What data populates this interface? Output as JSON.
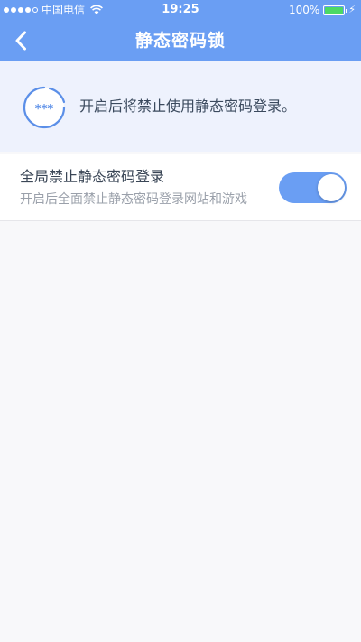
{
  "status_bar": {
    "carrier": "中国电信",
    "time": "19:25",
    "battery_percent": "100%",
    "signal_bars_filled": 4,
    "signal_bars_total": 5
  },
  "nav": {
    "title": "静态密码锁",
    "back_icon": "chevron-left-icon"
  },
  "banner": {
    "icon": "password-lock-icon",
    "icon_text": "***",
    "text": "开启后将禁止使用静态密码登录。"
  },
  "setting": {
    "title": "全局禁止静态密码登录",
    "subtitle": "开启后全面禁止静态密码登录网站和游戏",
    "enabled": true
  },
  "colors": {
    "accent": "#6a9ef3",
    "banner_bg": "#eef2fd",
    "battery_green": "#4cd964"
  }
}
